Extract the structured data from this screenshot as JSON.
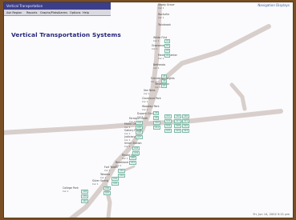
{
  "window": {
    "title": "Vertical Transportation",
    "menu": [
      "Ask Region",
      "Reports",
      "Graphs/Plots",
      "Alarms",
      "Options",
      "Help"
    ],
    "degraded_link": "Navigation Displays",
    "heading": "Vertical Transportation Systems",
    "clock": "Fri, Jun 14, 2002  5:21 pm"
  },
  "stations": [
    {
      "name": "Shady Grove",
      "sub": "Car 1"
    },
    {
      "name": "Rockville",
      "sub": "Car 1"
    },
    {
      "name": "Twinbrook",
      "sub": ""
    },
    {
      "name": "White Flint",
      "sub": "Car 1"
    },
    {
      "name": "Grosvenor",
      "sub": "Car 1"
    },
    {
      "name": "Medical Center",
      "sub": "Car 1"
    },
    {
      "name": "Bethesda",
      "sub": "Car 1"
    },
    {
      "name": "Friendship Heights",
      "sub": "Car 1"
    },
    {
      "name": "Tenleytown",
      "sub": "Car 1"
    },
    {
      "name": "Van Ness",
      "sub": "Car 1"
    },
    {
      "name": "Cleveland Park",
      "sub": "Car 1"
    },
    {
      "name": "Woodley Park",
      "sub": "Car 1"
    },
    {
      "name": "Dupont Circle",
      "sub": "Car 1"
    },
    {
      "name": "Farragut North",
      "sub": "Car 1"
    },
    {
      "name": "Metro Center",
      "sub": "Car 1"
    },
    {
      "name": "Gallery Place",
      "sub": "Car 1"
    },
    {
      "name": "Judiciary Sq",
      "sub": "Car 1"
    },
    {
      "name": "Union Station",
      "sub": "Car 1"
    },
    {
      "name": "Rhode Island",
      "sub": "Car 1"
    },
    {
      "name": "Brookland",
      "sub": "Car 1"
    },
    {
      "name": "Fort Totten",
      "sub": "Car 1"
    },
    {
      "name": "Takoma",
      "sub": "Car 1"
    },
    {
      "name": "Silver Spring",
      "sub": "Car 1"
    },
    {
      "name": "College Park",
      "sub": "Car 1"
    }
  ],
  "cars": [
    "C1",
    "C2",
    "C3",
    "C4",
    "C5",
    "C6",
    "C7",
    "C8",
    "C9",
    "C10",
    "C11",
    "C12",
    "C13",
    "C14",
    "C15",
    "C16",
    "C17",
    "C18",
    "C19",
    "C20",
    "C21",
    "C22",
    "C23",
    "C24",
    "C25",
    "C26",
    "C27",
    "C28",
    "C29",
    "C30",
    "C31",
    "C32",
    "C33",
    "C34",
    "C35",
    "C36",
    "C37",
    "C38",
    "C39",
    "C40"
  ],
  "colors": {
    "track": "#d8cfcc",
    "heading": "#23237a",
    "car": "#1e7d6c"
  }
}
